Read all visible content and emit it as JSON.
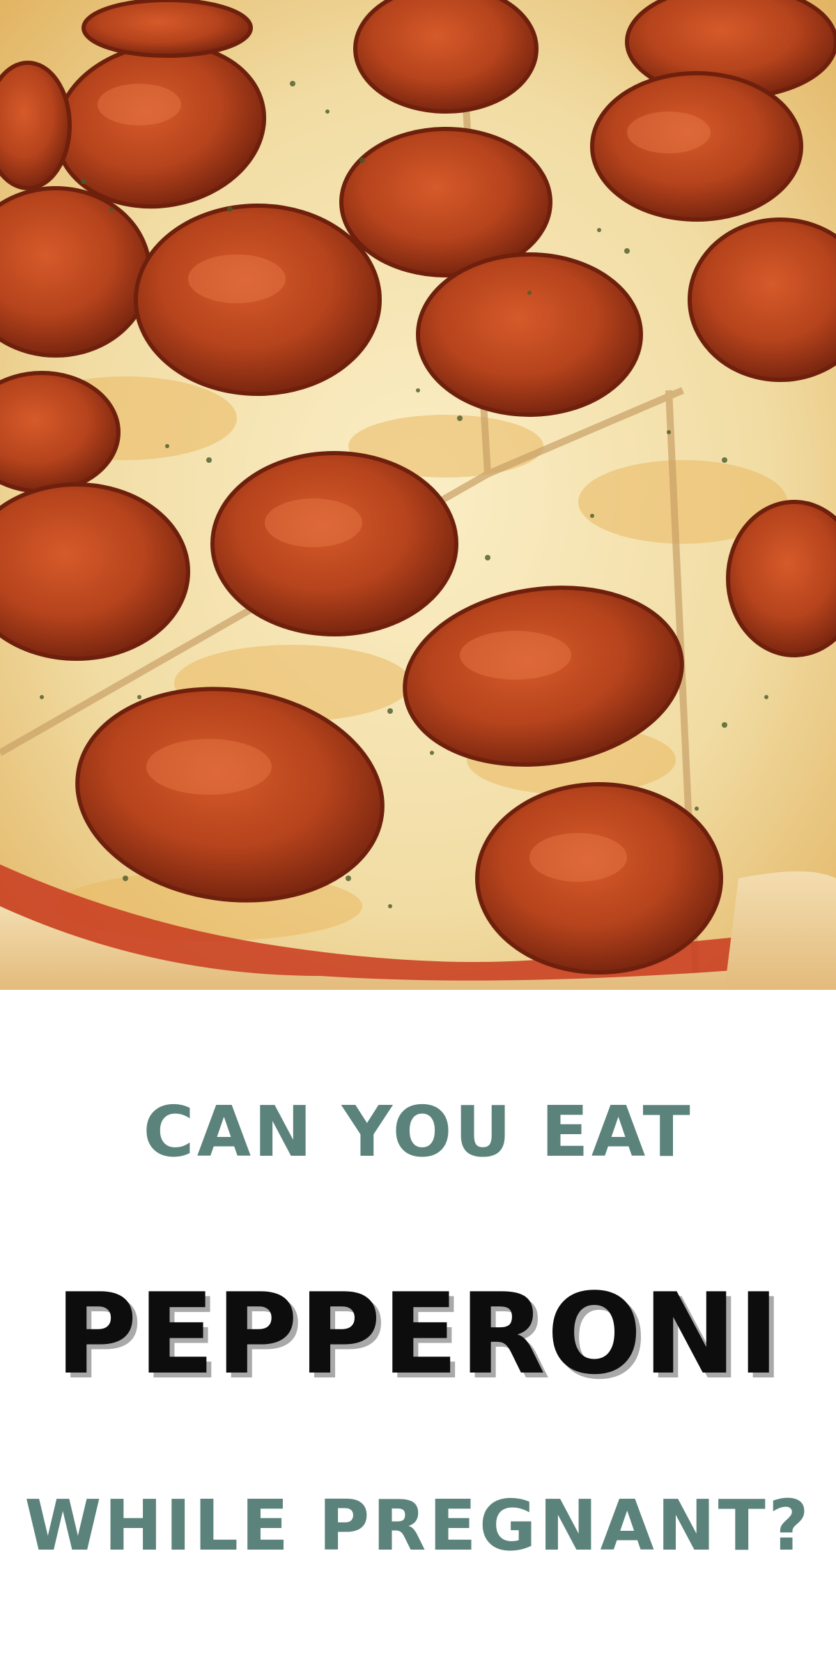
{
  "photo": {
    "subject": "pepperoni pizza close-up",
    "colors": {
      "cheese": "#f1dca3",
      "cheese_melt": "#e9b862",
      "pepperoni": "#b5431c",
      "pepperoni_dark": "#7a2410",
      "crust": "#f0d7a6",
      "sauce": "#c83a1e",
      "herb": "#4a5a2a"
    }
  },
  "headline": {
    "line1": "CAN YOU EAT",
    "line2": "PEPPERONI",
    "line3": "WHILE PREGNANT?"
  },
  "colors": {
    "accent_teal": "#5b837c",
    "title_black": "#0d0d0d",
    "shadow_gray": "#a9a9a9",
    "background": "#ffffff"
  }
}
